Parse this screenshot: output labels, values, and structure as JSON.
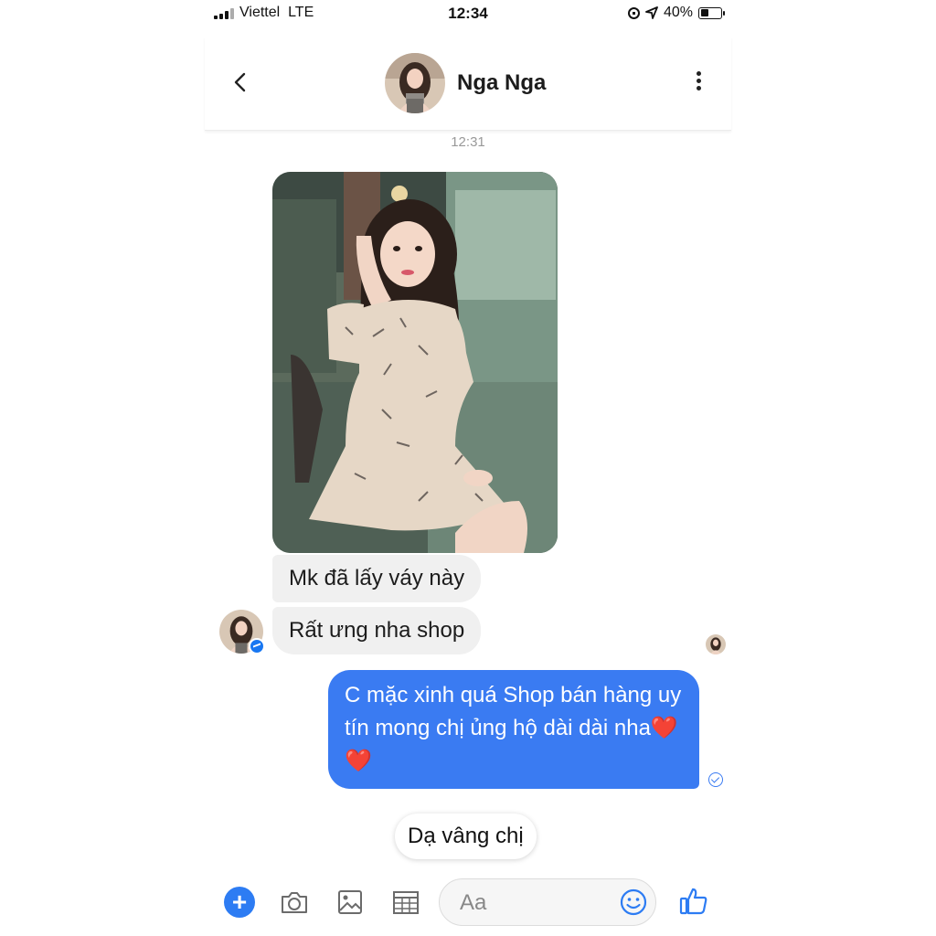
{
  "status_bar": {
    "carrier": "Viettel",
    "network": "LTE",
    "time": "12:34",
    "battery": "40%",
    "battery_level": 0.4
  },
  "header": {
    "contact_name": "Nga Nga"
  },
  "conversation": {
    "timestamp": "12:31",
    "incoming": [
      "Mk đã lấy váy này",
      "Rất ưng nha shop"
    ],
    "outgoing": {
      "text": "C mặc xinh quá  Shop bán hàng uy tín mong chị ủng hộ dài dài nha",
      "emoji": "❤️❤️"
    },
    "quick_reply": "Dạ vâng chị"
  },
  "composer": {
    "placeholder": "Aa"
  },
  "colors": {
    "accent": "#2d7cf3",
    "outgoing_bubble": "#3a7bf2",
    "incoming_bubble": "#f0f0f0"
  },
  "icons": [
    "back-icon",
    "more-icon",
    "plus-icon",
    "camera-icon",
    "image-icon",
    "grid-icon",
    "emoji-icon",
    "like-icon",
    "messenger-badge-icon",
    "sent-check-icon"
  ]
}
